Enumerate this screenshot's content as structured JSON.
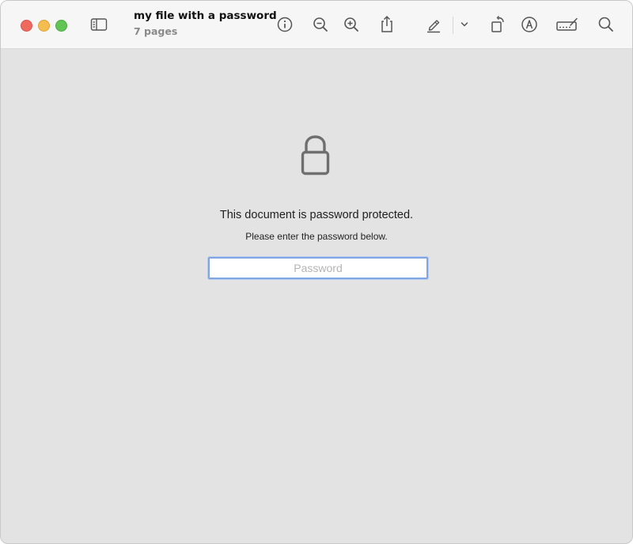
{
  "window": {
    "title": "my file with a password",
    "subtitle": "7 pages"
  },
  "toolbar": {
    "icons": [
      "sidebar-icon",
      "info-icon",
      "zoom-out-icon",
      "zoom-in-icon",
      "share-icon",
      "highlight-pen-icon",
      "chevron-down-icon",
      "rotate-icon",
      "markup-icon",
      "signature-icon",
      "search-icon"
    ]
  },
  "content": {
    "lock_icon": "lock-icon",
    "message_title": "This document is password protected.",
    "message_sub": "Please enter the password below.",
    "password": {
      "placeholder": "Password",
      "value": ""
    }
  },
  "colors": {
    "close": "#ee6a5f",
    "minimize": "#f5bd4f",
    "maximize": "#61c454",
    "focus_ring": "#7fa6e3",
    "background": "#e3e3e3"
  }
}
